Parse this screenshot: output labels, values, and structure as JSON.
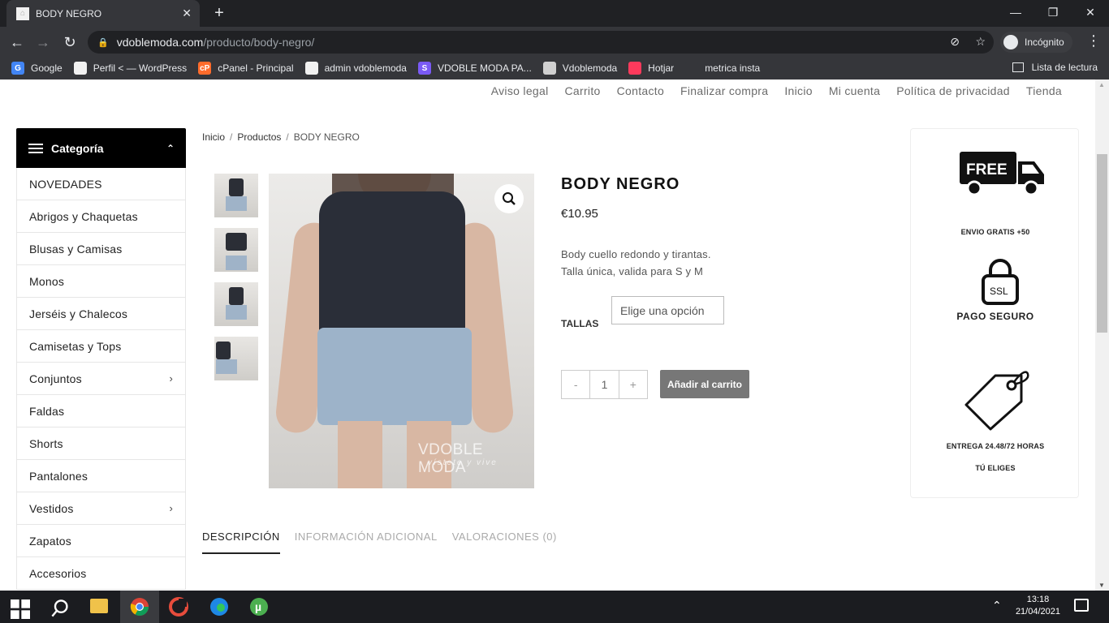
{
  "browser": {
    "tab_title": "BODY NEGRO",
    "tab_close": "✕",
    "new_tab": "+",
    "url_host": "vdoblemoda.com",
    "url_path": "/producto/body-negro/",
    "incognito_label": "Incógnito",
    "reading_list": "Lista de lectura",
    "bookmarks": [
      {
        "label": "Google",
        "color": "#4285f4",
        "glyph": "G"
      },
      {
        "label": "Perfil < — WordPress",
        "color": "#f1f1f1",
        "glyph": ""
      },
      {
        "label": "cPanel - Principal",
        "color": "#ff6c2c",
        "glyph": "cP"
      },
      {
        "label": "admin vdoblemoda",
        "color": "#f1f1f1",
        "glyph": ""
      },
      {
        "label": "VDOBLE MODA PA...",
        "color": "#7a5af5",
        "glyph": "S"
      },
      {
        "label": "Vdoblemoda",
        "color": "#d0d0d0",
        "glyph": ""
      },
      {
        "label": "Hotjar",
        "color": "#fd3a5c",
        "glyph": ""
      },
      {
        "label": "metrica insta",
        "color": "#35363a",
        "glyph": ""
      }
    ]
  },
  "site": {
    "top_nav": [
      "Aviso legal",
      "Carrito",
      "Contacto",
      "Finalizar compra",
      "Inicio",
      "Mi cuenta",
      "Política de privacidad",
      "Tienda"
    ],
    "category_header": "Categoría",
    "categories": [
      {
        "label": "NOVEDADES",
        "sub": ""
      },
      {
        "label": "Abrigos y Chaquetas",
        "sub": ""
      },
      {
        "label": "Blusas y Camisas",
        "sub": ""
      },
      {
        "label": "Monos",
        "sub": ""
      },
      {
        "label": "Jerséis y Chalecos",
        "sub": ""
      },
      {
        "label": "Camisetas y Tops",
        "sub": ""
      },
      {
        "label": "Conjuntos",
        "sub": "›"
      },
      {
        "label": "Faldas",
        "sub": ""
      },
      {
        "label": "Shorts",
        "sub": ""
      },
      {
        "label": "Pantalones",
        "sub": ""
      },
      {
        "label": "Vestidos",
        "sub": "›"
      },
      {
        "label": "Zapatos",
        "sub": ""
      },
      {
        "label": "Accesorios",
        "sub": ""
      }
    ],
    "breadcrumb": {
      "home": "Inicio",
      "sep": "/",
      "products": "Productos",
      "current": "BODY NEGRO"
    },
    "product": {
      "title": "BODY NEGRO",
      "price": "€10.95",
      "desc_line1": "Body cuello redondo y tirantas.",
      "desc_line2": "Talla única, valida para S y M",
      "size_label": "TALLAS",
      "size_placeholder": "Elige una opción",
      "qty_minus": "-",
      "qty_value": "1",
      "qty_plus": "+",
      "add_to_cart": "Añadir al carrito",
      "watermark": "VDOBLE MODA",
      "watermark_tagline": "vístete y vive"
    },
    "tabs": [
      "DESCRIPCIÓN",
      "INFORMACIÓN ADICIONAL",
      "VALORACIONES (0)"
    ],
    "badges": {
      "free_truck_text": "FREE",
      "free_label": "ENVIO GRATIS +50",
      "ssl_text": "SSL",
      "ssl_label": "PAGO SEGURO",
      "delivery_label": "ENTREGA 24.48/72 HORAS",
      "delivery_sub": "TÚ ELIGES"
    }
  },
  "taskbar": {
    "time": "13:18",
    "date": "21/04/2021"
  }
}
